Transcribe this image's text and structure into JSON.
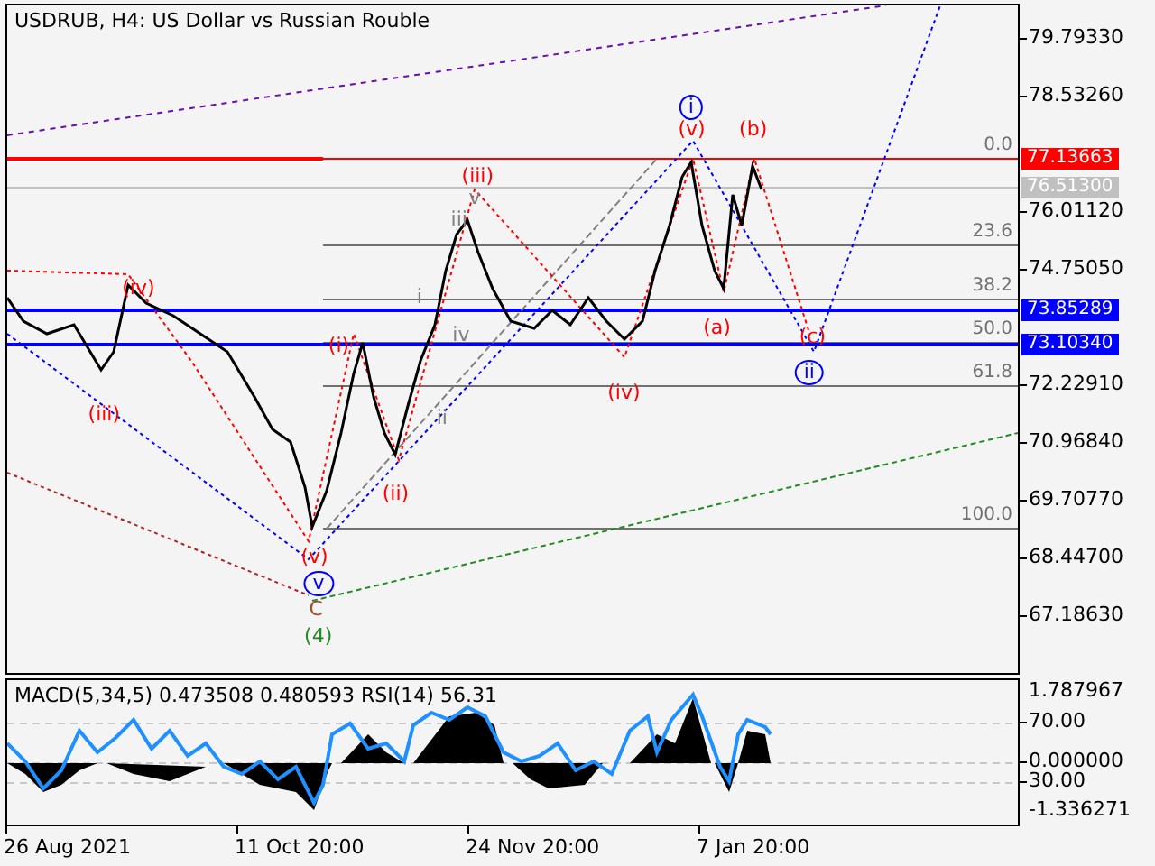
{
  "chart": {
    "title": "USDRUB, H4:  US Dollar vs Russian Rouble",
    "price_axis": [
      "79.79330",
      "78.53260",
      "76.01120",
      "74.75050",
      "72.22910",
      "70.96840",
      "69.70770",
      "68.44700",
      "67.18630"
    ],
    "price_tags": [
      {
        "text": "77.13663",
        "color": "#ff0000"
      },
      {
        "text": "76.51300",
        "color": "#c0c0c0"
      },
      {
        "text": "73.85289",
        "color": "#0000ff"
      },
      {
        "text": "73.10340",
        "color": "#0000ff"
      }
    ],
    "fibo_levels": [
      "0.0",
      "23.6",
      "38.2",
      "50.0",
      "61.8",
      "100.0"
    ],
    "wave_labels": [
      {
        "text": "(iv)",
        "color": "#ff0000",
        "kind": "plain"
      },
      {
        "text": "(iii)",
        "color": "#ff0000",
        "kind": "plain"
      },
      {
        "text": "(i)",
        "color": "#ff0000",
        "kind": "plain"
      },
      {
        "text": "(ii)",
        "color": "#ff0000",
        "kind": "plain"
      },
      {
        "text": "(v)",
        "color": "#ff0000",
        "kind": "plain"
      },
      {
        "text": "v",
        "color": "#0000ff",
        "kind": "circled"
      },
      {
        "text": "C",
        "color": "#a0522d",
        "kind": "plain"
      },
      {
        "text": "(4)",
        "color": "#228b22",
        "kind": "plain"
      },
      {
        "text": "(iii)",
        "color": "#ff0000",
        "kind": "plain"
      },
      {
        "text": "v",
        "color": "#808080",
        "kind": "plain"
      },
      {
        "text": "iii",
        "color": "#808080",
        "kind": "plain"
      },
      {
        "text": "i",
        "color": "#808080",
        "kind": "plain"
      },
      {
        "text": "iv",
        "color": "#808080",
        "kind": "plain"
      },
      {
        "text": "ii",
        "color": "#808080",
        "kind": "plain"
      },
      {
        "text": "(iv)",
        "color": "#ff0000",
        "kind": "plain"
      },
      {
        "text": "(v)",
        "color": "#ff0000",
        "kind": "plain"
      },
      {
        "text": "i",
        "color": "#0000ff",
        "kind": "circled"
      },
      {
        "text": "(b)",
        "color": "#ff0000",
        "kind": "plain"
      },
      {
        "text": "(a)",
        "color": "#ff0000",
        "kind": "plain"
      },
      {
        "text": "(c)",
        "color": "#ff0000",
        "kind": "plain"
      },
      {
        "text": "ii",
        "color": "#0000ff",
        "kind": "circled"
      }
    ]
  },
  "indicator": {
    "caption": "MACD(5,34,5) 0.473508 0.480593 RSI(14) 56.31",
    "axis": [
      "1.787967",
      "70.00",
      "0.000000",
      "30.00",
      "-1.336271"
    ]
  },
  "time_axis": [
    "26 Aug 2021",
    "11 Oct 20:00",
    "24 Nov 20:00",
    "7 Jan 20:00"
  ]
}
